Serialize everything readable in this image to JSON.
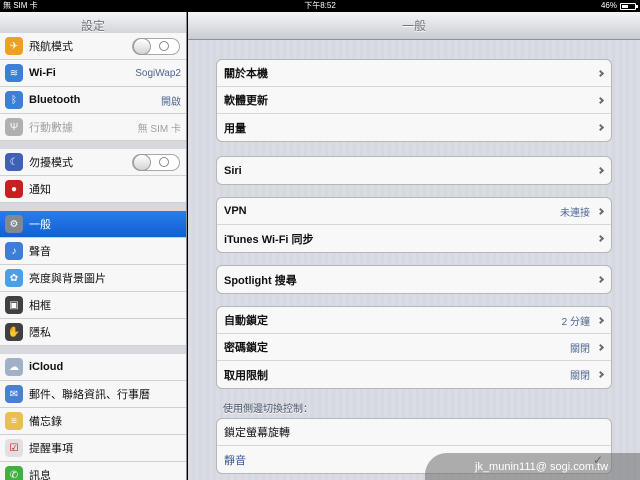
{
  "status": {
    "carrier": "無 SIM 卡",
    "time": "下午8:52",
    "battery_text": "46%",
    "battery_level": 0.46
  },
  "sidebar": {
    "title": "設定",
    "items": [
      {
        "label": "飛航模式",
        "icon": "airplane-icon",
        "color": "#f0a020",
        "toggle": true
      },
      {
        "label": "Wi-Fi",
        "icon": "wifi-icon",
        "color": "#3d7fd8",
        "value": "SogiWap2"
      },
      {
        "label": "Bluetooth",
        "icon": "bluetooth-icon",
        "color": "#3d7fd8",
        "value": "開啟"
      },
      {
        "label": "行動數據",
        "icon": "antenna-icon",
        "color": "#b0b0b0",
        "value": "無 SIM 卡",
        "dim": true
      },
      {
        "label": "勿擾模式",
        "icon": "moon-icon",
        "color": "#4060b8",
        "toggle": true
      },
      {
        "label": "通知",
        "icon": "notification-icon",
        "color": "#c82020"
      },
      {
        "label": "一般",
        "icon": "gear-icon",
        "color": "#808890",
        "selected": true
      },
      {
        "label": "聲音",
        "icon": "speaker-icon",
        "color": "#3d7fd8"
      },
      {
        "label": "亮度與背景圖片",
        "icon": "flower-icon",
        "color": "#4aa0e8"
      },
      {
        "label": "相框",
        "icon": "picture-frame-icon",
        "color": "#404040"
      },
      {
        "label": "隱私",
        "icon": "hand-icon",
        "color": "#404040"
      },
      {
        "label": "iCloud",
        "icon": "cloud-icon",
        "color": "#a0b0c8"
      },
      {
        "label": "郵件、聯絡資訊、行事曆",
        "icon": "mail-icon",
        "color": "#4a80d0"
      },
      {
        "label": "備忘錄",
        "icon": "notes-icon",
        "color": "#e8c050"
      },
      {
        "label": "提醒事項",
        "icon": "reminders-icon",
        "color": "#e0e0e0"
      },
      {
        "label": "訊息",
        "icon": "messages-icon",
        "color": "#40b040"
      }
    ]
  },
  "main": {
    "title": "一般",
    "groups": [
      {
        "rows": [
          {
            "label": "關於本機",
            "chevron": true
          },
          {
            "label": "軟體更新",
            "chevron": true
          },
          {
            "label": "用量",
            "chevron": true
          }
        ]
      },
      {
        "rows": [
          {
            "label": "Siri",
            "chevron": true
          }
        ]
      },
      {
        "rows": [
          {
            "label": "VPN",
            "value": "未連接",
            "chevron": true
          },
          {
            "label": "iTunes Wi-Fi 同步",
            "chevron": true
          }
        ]
      },
      {
        "rows": [
          {
            "label": "Spotlight 搜尋",
            "chevron": true
          }
        ]
      },
      {
        "rows": [
          {
            "label": "自動鎖定",
            "value": "2 分鐘",
            "chevron": true
          },
          {
            "label": "密碼鎖定",
            "value": "關閉",
            "chevron": true
          },
          {
            "label": "取用限制",
            "value": "關閉",
            "chevron": true
          }
        ]
      },
      {
        "rows": [
          {
            "label": "鎖定螢幕旋轉",
            "normal": true
          },
          {
            "label": "靜音",
            "checked": true
          }
        ]
      }
    ],
    "section_label": "使用側邊切換控制："
  },
  "watermark": "jk_munin111@ sogi.com.tw"
}
